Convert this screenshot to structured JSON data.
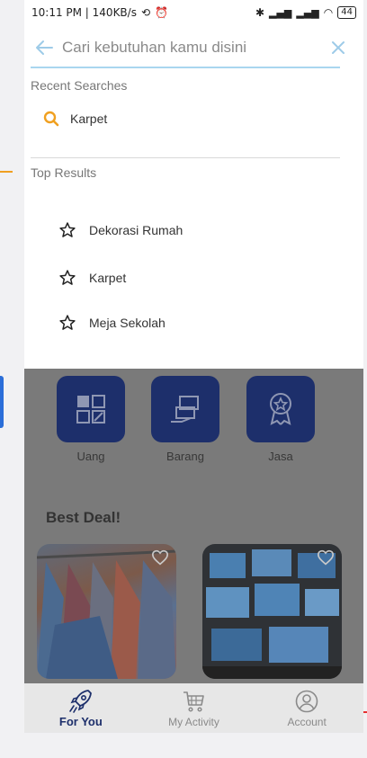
{
  "status_bar": {
    "left_text": "10:11 PM | 140KB/s",
    "battery": "44"
  },
  "search": {
    "placeholder": "Cari kebutuhan kamu disini",
    "value": ""
  },
  "recent_searches": {
    "title": "Recent Searches",
    "items": [
      "Karpet"
    ]
  },
  "top_results": {
    "title": "Top Results",
    "items": [
      "Dekorasi Rumah",
      "Karpet",
      "Meja Sekolah"
    ]
  },
  "categories": [
    "Uang",
    "Barang",
    "Jasa"
  ],
  "best_deal_title": "Best Deal!",
  "bottom_nav": {
    "items": [
      {
        "label": "For You",
        "active": true
      },
      {
        "label": "My Activity",
        "active": false
      },
      {
        "label": "Account",
        "active": false
      }
    ]
  },
  "colors": {
    "primary": "#1d2f6b",
    "accent_back": "#9ecbe8",
    "search_icon": "#f0a020",
    "underline": "#a9d6ef"
  }
}
